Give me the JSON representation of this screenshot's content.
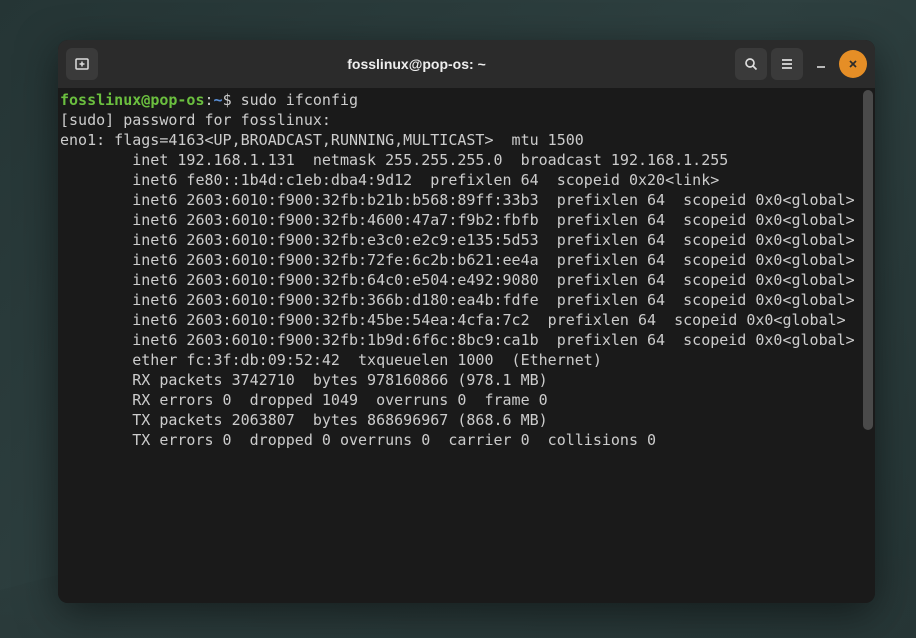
{
  "titlebar": {
    "title": "fosslinux@pop-os: ~"
  },
  "prompt": {
    "user": "fosslinux",
    "at": "@",
    "host": "pop-os",
    "sep": ":",
    "path": "~",
    "symbol": "$ "
  },
  "command": "sudo ifconfig",
  "lines": [
    "[sudo] password for fosslinux:",
    "eno1: flags=4163<UP,BROADCAST,RUNNING,MULTICAST>  mtu 1500",
    "        inet 192.168.1.131  netmask 255.255.255.0  broadcast 192.168.1.255",
    "        inet6 fe80::1b4d:c1eb:dba4:9d12  prefixlen 64  scopeid 0x20<link>",
    "        inet6 2603:6010:f900:32fb:b21b:b568:89ff:33b3  prefixlen 64  scopeid 0x0<global>",
    "        inet6 2603:6010:f900:32fb:4600:47a7:f9b2:fbfb  prefixlen 64  scopeid 0x0<global>",
    "        inet6 2603:6010:f900:32fb:e3c0:e2c9:e135:5d53  prefixlen 64  scopeid 0x0<global>",
    "        inet6 2603:6010:f900:32fb:72fe:6c2b:b621:ee4a  prefixlen 64  scopeid 0x0<global>",
    "        inet6 2603:6010:f900:32fb:64c0:e504:e492:9080  prefixlen 64  scopeid 0x0<global>",
    "        inet6 2603:6010:f900:32fb:366b:d180:ea4b:fdfe  prefixlen 64  scopeid 0x0<global>",
    "        inet6 2603:6010:f900:32fb:45be:54ea:4cfa:7c2  prefixlen 64  scopeid 0x0<global>",
    "        inet6 2603:6010:f900:32fb:1b9d:6f6c:8bc9:ca1b  prefixlen 64  scopeid 0x0<global>",
    "        ether fc:3f:db:09:52:42  txqueuelen 1000  (Ethernet)",
    "        RX packets 3742710  bytes 978160866 (978.1 MB)",
    "        RX errors 0  dropped 1049  overruns 0  frame 0",
    "        TX packets 2063807  bytes 868696967 (868.6 MB)",
    "        TX errors 0  dropped 0 overruns 0  carrier 0  collisions 0"
  ]
}
